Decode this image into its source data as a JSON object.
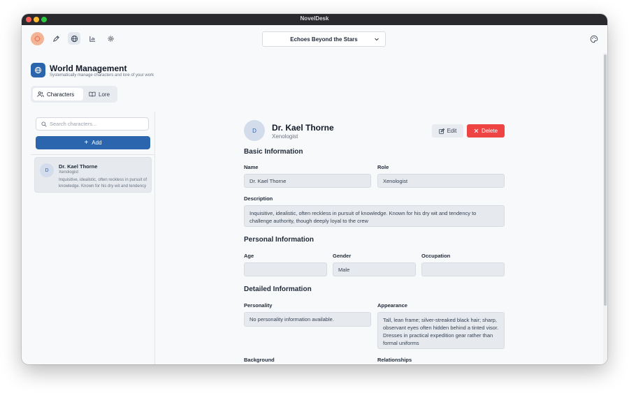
{
  "window": {
    "title": "NovelDesk"
  },
  "toolbar": {
    "book_title": "Echoes Beyond the Stars"
  },
  "header": {
    "title": "World Management",
    "subtitle": "Systematically manage characters and lore of your work"
  },
  "tabs": [
    {
      "label": "Characters",
      "active": true
    },
    {
      "label": "Lore",
      "active": false
    }
  ],
  "sidebar": {
    "search_placeholder": "Search characters...",
    "add_label": "Add",
    "characters": [
      {
        "initial": "D",
        "name": "Dr. Kael Thorne",
        "role": "Xenologist",
        "description": "Inquisitive, idealistic, often reckless in pursuit of knowledge. Known for his dry wit and tendency to challenge authority, though deeply loyal to the crew"
      }
    ]
  },
  "detail": {
    "initial": "D",
    "name": "Dr. Kael Thorne",
    "role": "Xenologist",
    "edit_label": "Edit",
    "delete_label": "Delete",
    "basic": {
      "title": "Basic Information",
      "name_label": "Name",
      "name_value": "Dr. Kael Thorne",
      "role_label": "Role",
      "role_value": "Xenologist",
      "description_label": "Description",
      "description_value": "Inquisitive, idealistic, often reckless in pursuit of knowledge. Known for his dry wit and tendency to challenge authority, though deeply loyal to the crew"
    },
    "personal": {
      "title": "Personal Information",
      "age_label": "Age",
      "age_value": "",
      "gender_label": "Gender",
      "gender_value": "Male",
      "occupation_label": "Occupation",
      "occupation_value": ""
    },
    "detailed": {
      "title": "Detailed Information",
      "personality_label": "Personality",
      "personality_value": "No personality information available.",
      "appearance_label": "Appearance",
      "appearance_value": "Tall, lean frame; silver-streaked black hair; sharp, observant eyes often hidden behind a tinted visor. Dresses in practical expedition gear rather than formal uniforms",
      "background_label": "Background",
      "relationships_label": "Relationships"
    }
  },
  "colors": {
    "accent": "#2b65ad",
    "danger": "#ef4444",
    "field": "#e6eaef"
  }
}
